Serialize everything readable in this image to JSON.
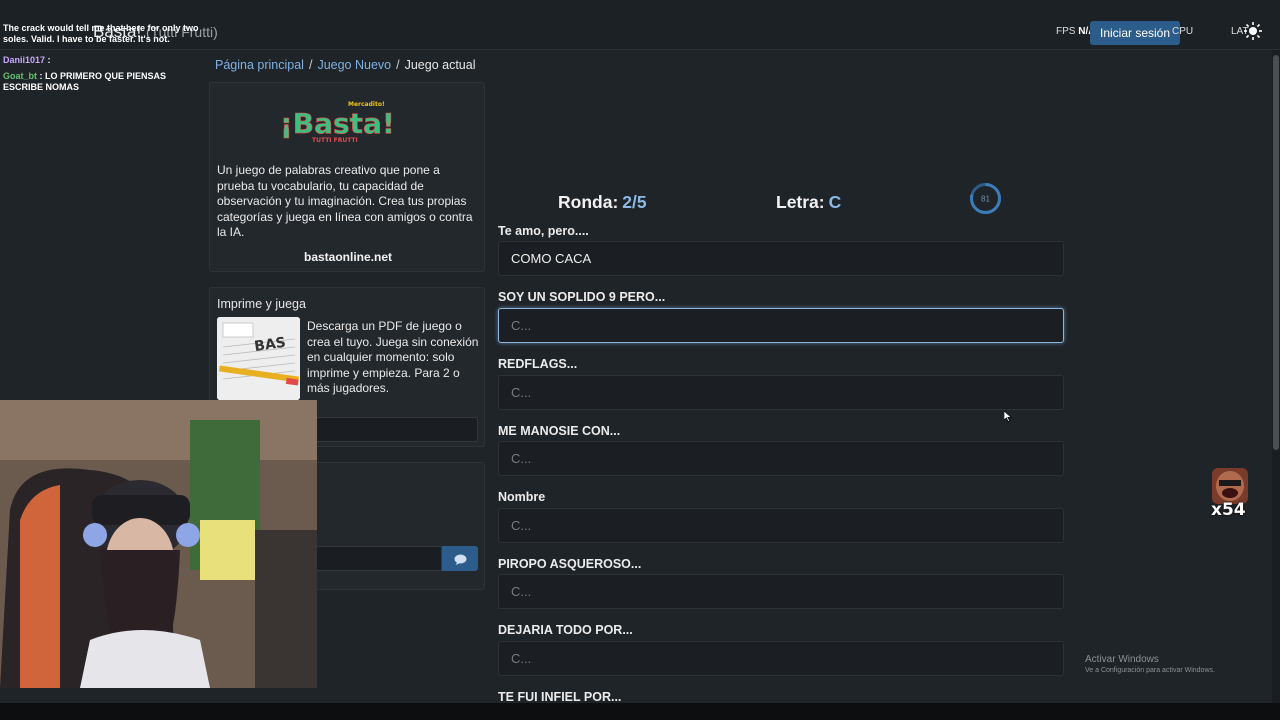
{
  "header": {
    "brand": "Basta!",
    "brand_sub": "(Tutti Frutti)",
    "fps_label": "FPS",
    "fps_value": "N/A",
    "login_label": "Iniciar sesión",
    "cpu_label": "CPU",
    "lang_label": "LAT"
  },
  "breadcrumb": {
    "home": "Página principal",
    "new_game": "Juego Nuevo",
    "current": "Juego actual"
  },
  "about": {
    "logo_text": "¡Basta!",
    "logo_top": "Mercadito!",
    "logo_bottom": "TUTTI FRUTTI",
    "description": "Un juego de palabras creativo que pone a prueba tu vocabulario, tu capacidad de observación y tu imaginación. Crea tus propias categorías y juega en línea con amigos o contra la IA.",
    "link": "bastaonline.net"
  },
  "print": {
    "title": "Imprime y juega",
    "description": "Descarga un PDF de juego o crea el tuyo. Juega sin conexión en cualquier momento: solo imprime y empieza. Para 2 o más jugadores.",
    "button": "Imprime y juega"
  },
  "game": {
    "round_label": "Ronda:",
    "round_value": "2/5",
    "letter_label": "Letra:",
    "letter_value": "C",
    "timer": "81",
    "fields": [
      {
        "label": "Te amo, pero....",
        "value": "COMO CACA",
        "placeholder": "C..."
      },
      {
        "label": "SOY UN SOPLIDO 9 PERO...",
        "value": "",
        "placeholder": "C..."
      },
      {
        "label": "REDFLAGS...",
        "value": "",
        "placeholder": "C..."
      },
      {
        "label": "ME MANOSIE CON...",
        "value": "",
        "placeholder": "C..."
      },
      {
        "label": "Nombre",
        "value": "",
        "placeholder": "C..."
      },
      {
        "label": "PIROPO ASQUEROSO...",
        "value": "",
        "placeholder": "C..."
      },
      {
        "label": "DEJARIA TODO POR...",
        "value": "",
        "placeholder": "C..."
      },
      {
        "label": "TE FUI INFIEL POR...",
        "value": "",
        "placeholder": "C..."
      }
    ]
  },
  "stream_chat": {
    "line1": "The crack would tell me that here for only two soles. Valid. I have to be faster. It's not.",
    "user2": "Danii1017",
    "msg2": ":",
    "user3": "Goat_bt",
    "msg3": ": LO PRIMERO QUE PIENSAS ESCRIBE NOMAS"
  },
  "emote_count": "x54",
  "windows": {
    "activate_title": "Activar Windows",
    "activate_sub": "Ve a Configuración para activar Windows."
  },
  "colors": {
    "accent": "#8db8e6",
    "button": "#2b5c8a",
    "background": "#1f2429"
  }
}
